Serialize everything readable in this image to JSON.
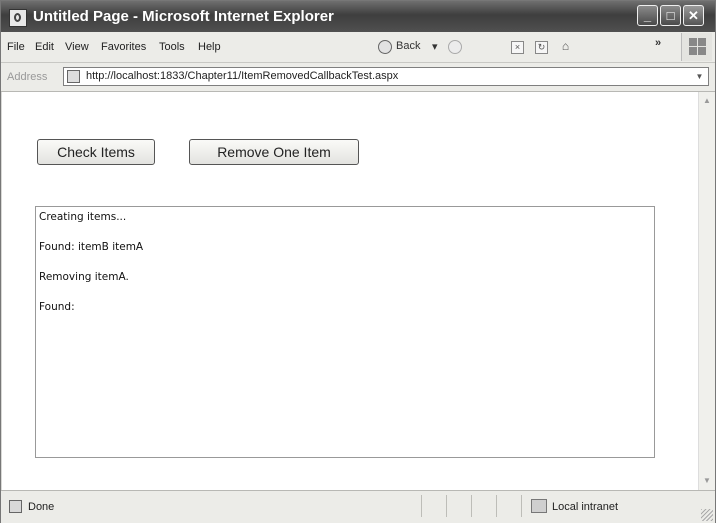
{
  "window": {
    "title": "Untitled Page - Microsoft Internet Explorer",
    "minimize_label": "_",
    "maximize_label": "□",
    "close_label": "✕"
  },
  "menu": {
    "items": [
      "File",
      "Edit",
      "View",
      "Favorites",
      "Tools",
      "Help"
    ]
  },
  "toolbar": {
    "back_label": "Back",
    "back_dropdown": "▾",
    "more_label": "»"
  },
  "address": {
    "label": "Address",
    "url": "http://localhost:1833/Chapter11/ItemRemovedCallbackTest.aspx"
  },
  "page": {
    "check_button": "Check Items",
    "remove_button": "Remove One Item",
    "output_lines": [
      "Creating items...",
      "Found: itemB itemA",
      "Removing itemA.",
      "Found:"
    ]
  },
  "status": {
    "text": "Done",
    "zone": "Local intranet"
  }
}
